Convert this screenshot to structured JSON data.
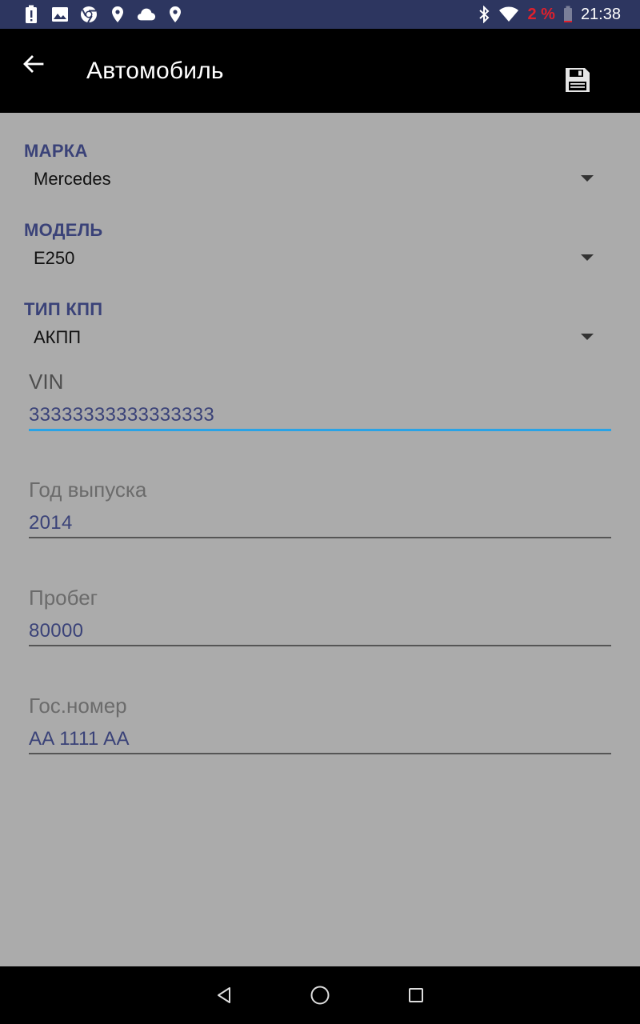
{
  "status_bar": {
    "left_icons": [
      "battery-alert-icon",
      "image-icon",
      "chrome-icon",
      "location-pin-icon",
      "cloud-icon",
      "location-pin-icon"
    ],
    "right_icons": [
      "bluetooth-icon",
      "wifi-icon",
      "battery-low-icon"
    ],
    "battery_percent": "2 %",
    "time": "21:38",
    "battery_color": "#e0202c"
  },
  "toolbar": {
    "title": "Автомобиль",
    "back_icon": "arrow-back-icon",
    "save_icon": "floppy-disk-icon"
  },
  "form": {
    "spinners": [
      {
        "label": "МАРКА",
        "value": "Mercedes"
      },
      {
        "label": "МОДЕЛЬ",
        "value": "E250"
      },
      {
        "label": "ТИП КПП",
        "value": "АКПП"
      }
    ],
    "fields": [
      {
        "label": "VIN",
        "value": "33333333333333333",
        "focused": true
      },
      {
        "label": "Год выпуска",
        "value": "2014",
        "focused": false
      },
      {
        "label": "Пробег",
        "value": "80000",
        "focused": false
      },
      {
        "label": "Гос.номер",
        "value": "AA 1111 AA",
        "focused": false
      }
    ]
  },
  "colors": {
    "accent": "#29a3e6",
    "label": "#3a4278",
    "background": "#ababab"
  },
  "nav_bar": {
    "icons": [
      "nav-back-icon",
      "nav-home-icon",
      "nav-recents-icon"
    ]
  }
}
